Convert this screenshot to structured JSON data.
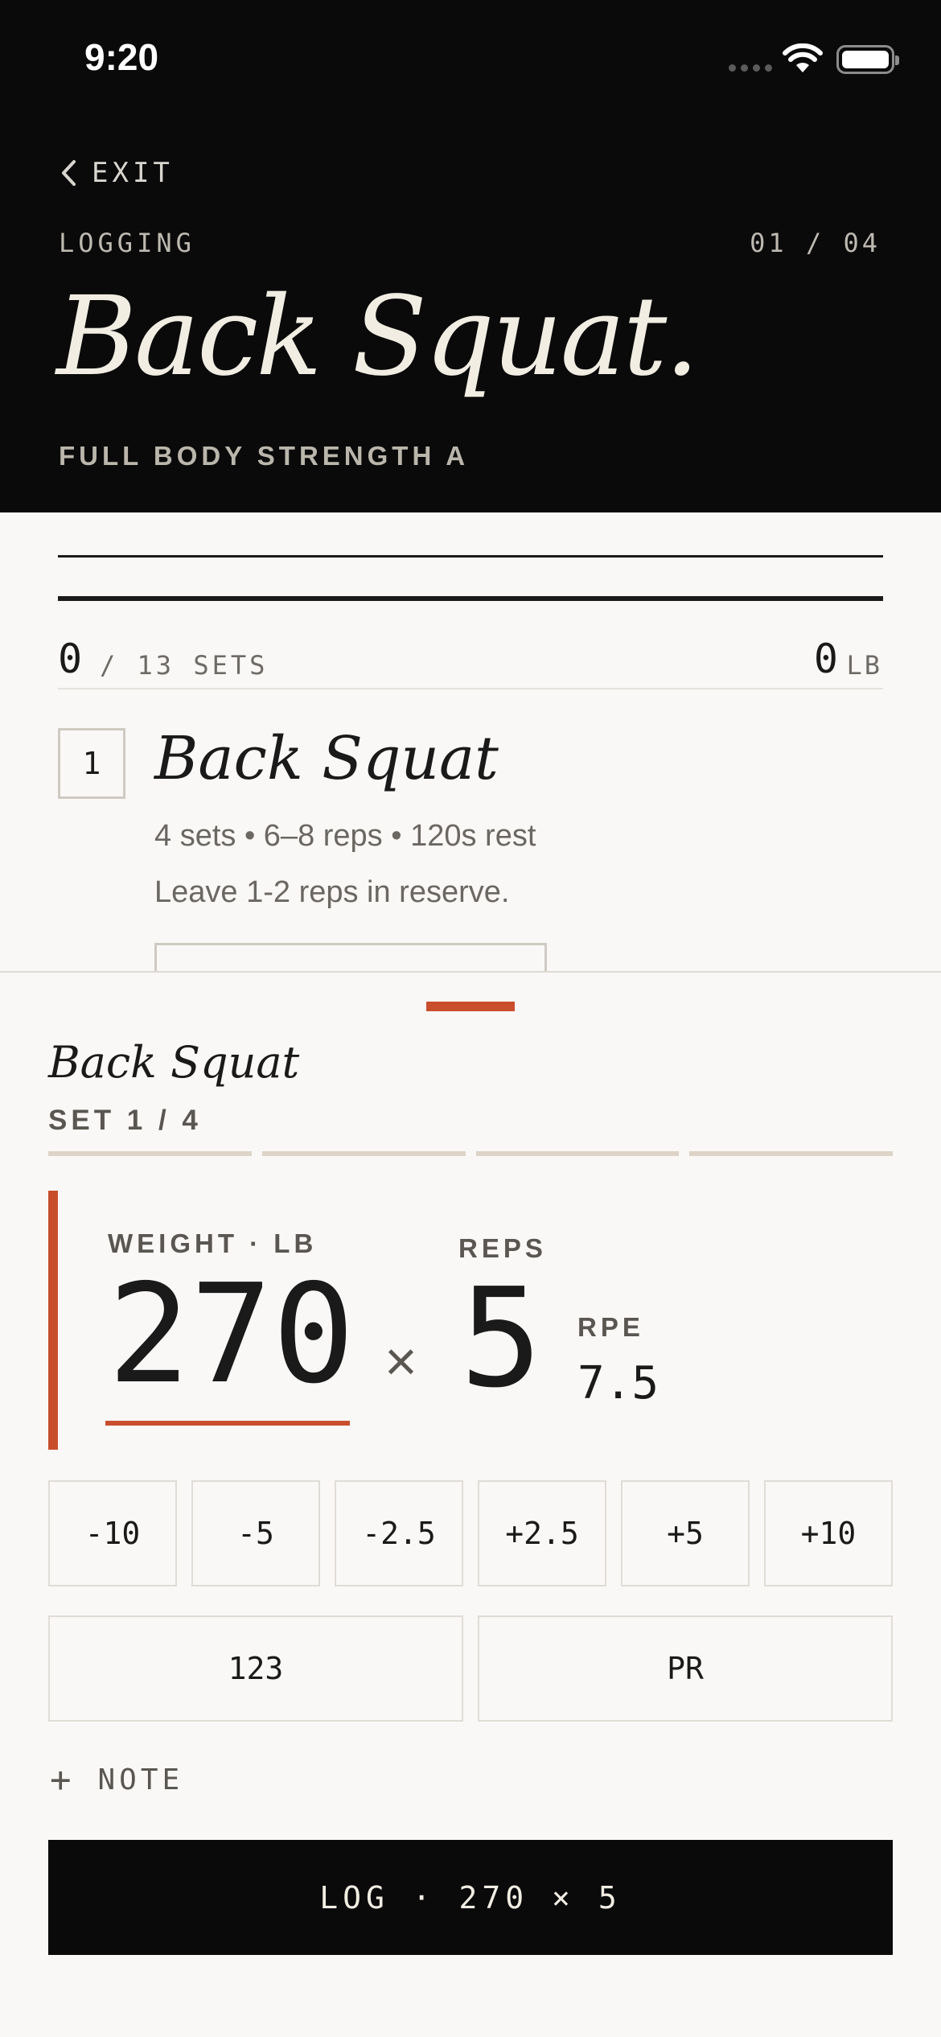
{
  "status_bar": {
    "time": "9:20"
  },
  "header": {
    "exit_label": "EXIT",
    "mode_label": "LOGGING",
    "progress_label": "01 / 04",
    "exercise_title": "Back Squat.",
    "workout_name": "FULL BODY STRENGTH A"
  },
  "summary": {
    "sets_done": "0",
    "sets_total": "/ 13 SETS",
    "volume": "0",
    "volume_unit": "LB"
  },
  "exercise": {
    "index": "1",
    "name": "Back Squat",
    "meta": "4 sets • 6–8 reps • 120s rest",
    "note": "Leave 1-2 reps in reserve."
  },
  "sheet": {
    "exercise_name": "Back Squat",
    "set_label": "SET 1 / 4",
    "set_count": 4,
    "weight_label": "WEIGHT · LB",
    "weight_value": "270",
    "times": "×",
    "reps_label": "REPS",
    "reps_value": "5",
    "rpe_label": "RPE",
    "rpe_value": "7.5",
    "adjust_buttons": [
      "-10",
      "-5",
      "-2.5",
      "+2.5",
      "+5",
      "+10"
    ],
    "keypad_label": "123",
    "pr_label": "PR",
    "note_plus": "+",
    "note_label": "NOTE",
    "log_label": "LOG · 270 × 5"
  },
  "colors": {
    "accent": "#c94f2c",
    "header_bg": "#0a0a0a",
    "page_bg": "#f9f8f6"
  }
}
